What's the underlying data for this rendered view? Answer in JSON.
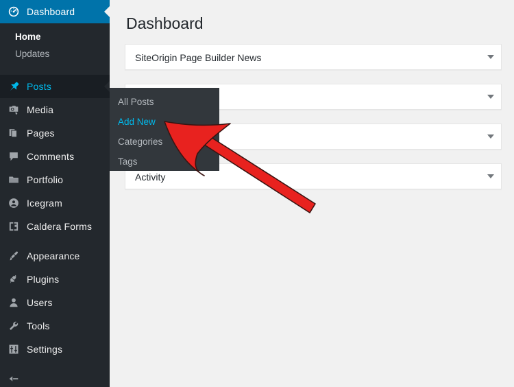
{
  "sidebar": {
    "items": [
      {
        "label": "Dashboard",
        "icon": "dashboard-gauge-icon",
        "state": "current",
        "children": [
          {
            "label": "Home",
            "active": true
          },
          {
            "label": "Updates",
            "active": false
          }
        ]
      },
      {
        "label": "Posts",
        "icon": "pin-icon",
        "state": "hovered"
      },
      {
        "label": "Media",
        "icon": "media-icon",
        "state": "normal"
      },
      {
        "label": "Pages",
        "icon": "pages-icon",
        "state": "normal"
      },
      {
        "label": "Comments",
        "icon": "comment-bubble-icon",
        "state": "normal"
      },
      {
        "label": "Portfolio",
        "icon": "portfolio-folder-icon",
        "state": "normal"
      },
      {
        "label": "Icegram",
        "icon": "user-circle-icon",
        "state": "normal"
      },
      {
        "label": "Caldera Forms",
        "icon": "form-bracket-icon",
        "state": "normal"
      },
      {
        "label": "Appearance",
        "icon": "paintbrush-icon",
        "state": "normal"
      },
      {
        "label": "Plugins",
        "icon": "plug-icon",
        "state": "normal"
      },
      {
        "label": "Users",
        "icon": "user-icon",
        "state": "normal"
      },
      {
        "label": "Tools",
        "icon": "wrench-icon",
        "state": "normal"
      },
      {
        "label": "Settings",
        "icon": "sliders-icon",
        "state": "normal"
      }
    ]
  },
  "flyout": {
    "parent": "Posts",
    "items": [
      {
        "label": "All Posts",
        "active": false
      },
      {
        "label": "Add New",
        "active": true
      },
      {
        "label": "Categories",
        "active": false
      },
      {
        "label": "Tags",
        "active": false
      }
    ]
  },
  "main": {
    "title": "Dashboard",
    "panels": [
      {
        "title": "SiteOrigin Page Builder News",
        "toggle": "chevron-down-icon"
      },
      {
        "title": "",
        "toggle": "chevron-down-icon"
      },
      {
        "title": "",
        "toggle": "chevron-down-icon"
      },
      {
        "title": "Activity",
        "toggle": "chevron-down-icon"
      }
    ]
  },
  "annotation": {
    "type": "arrow",
    "color": "#e8221f",
    "points_to": "Add New"
  },
  "colors": {
    "sidebar_bg": "#23282d",
    "submenu_bg": "#32373c",
    "current_bg": "#0073aa",
    "hover_text": "#00b9eb",
    "content_bg": "#f1f1f1",
    "panel_bg": "#ffffff",
    "arrow_red": "#e8221f"
  }
}
